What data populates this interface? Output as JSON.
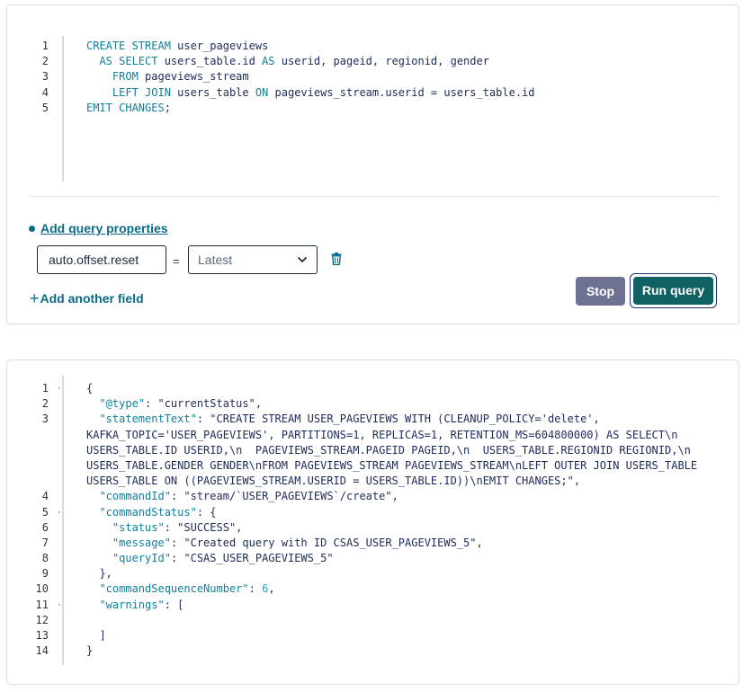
{
  "editor": {
    "line_numbers": [
      "1",
      "2",
      "3",
      "4",
      "5"
    ],
    "lines": [
      [
        {
          "t": "CREATE STREAM",
          "c": "kw"
        },
        {
          "t": " user_pageviews",
          "c": ""
        }
      ],
      [
        {
          "t": "  AS SELECT",
          "c": "kw"
        },
        {
          "t": " users_table.id ",
          "c": ""
        },
        {
          "t": "AS",
          "c": "kw"
        },
        {
          "t": " userid, pageid, regionid, gender",
          "c": ""
        }
      ],
      [
        {
          "t": "    FROM",
          "c": "kw"
        },
        {
          "t": " pageviews_stream",
          "c": ""
        }
      ],
      [
        {
          "t": "    LEFT JOIN",
          "c": "kw"
        },
        {
          "t": " users_table ",
          "c": ""
        },
        {
          "t": "ON",
          "c": "kw"
        },
        {
          "t": " pageviews_stream.userid = users_table.id",
          "c": ""
        }
      ],
      [
        {
          "t": "EMIT CHANGES",
          "c": "kw"
        },
        {
          "t": ";",
          "c": ""
        }
      ]
    ]
  },
  "properties": {
    "add_label": "Add query properties",
    "property_name": "auto.offset.reset",
    "equals": "=",
    "selected_value": "Latest",
    "add_field_label": "Add another field"
  },
  "buttons": {
    "stop_label": "Stop",
    "run_label": "Run query"
  },
  "result": {
    "line_numbers": [
      "1",
      "2",
      "3",
      "",
      "",
      "",
      "",
      "4",
      "5",
      "6",
      "7",
      "8",
      "9",
      "10",
      "11",
      "12",
      "13",
      "14"
    ],
    "fold_marks": [
      true,
      false,
      false,
      false,
      false,
      false,
      false,
      false,
      true,
      false,
      false,
      false,
      false,
      false,
      true,
      false,
      false,
      false
    ],
    "lines": [
      [
        {
          "t": "{",
          "c": ""
        }
      ],
      [
        {
          "t": "  ",
          "c": ""
        },
        {
          "t": "\"@type\"",
          "c": "key"
        },
        {
          "t": ": \"currentStatus\",",
          "c": ""
        }
      ],
      [
        {
          "t": "  ",
          "c": ""
        },
        {
          "t": "\"statementText\"",
          "c": "key"
        },
        {
          "t": ": \"CREATE STREAM USER_PAGEVIEWS WITH (CLEANUP_POLICY='delete',",
          "c": ""
        }
      ],
      [
        {
          "t": "KAFKA_TOPIC='USER_PAGEVIEWS', PARTITIONS=1, REPLICAS=1, RETENTION_MS=604800000) AS SELECT\\n",
          "c": ""
        }
      ],
      [
        {
          "t": "USERS_TABLE.ID USERID,\\n  PAGEVIEWS_STREAM.PAGEID PAGEID,\\n  USERS_TABLE.REGIONID REGIONID,\\n",
          "c": ""
        }
      ],
      [
        {
          "t": "USERS_TABLE.GENDER GENDER\\nFROM PAGEVIEWS_STREAM PAGEVIEWS_STREAM\\nLEFT OUTER JOIN USERS_TABLE",
          "c": ""
        }
      ],
      [
        {
          "t": "USERS_TABLE ON ((PAGEVIEWS_STREAM.USERID = USERS_TABLE.ID))\\nEMIT CHANGES;\",",
          "c": ""
        }
      ],
      [
        {
          "t": "  ",
          "c": ""
        },
        {
          "t": "\"commandId\"",
          "c": "key"
        },
        {
          "t": ": \"stream/`USER_PAGEVIEWS`/create\",",
          "c": ""
        }
      ],
      [
        {
          "t": "  ",
          "c": ""
        },
        {
          "t": "\"commandStatus\"",
          "c": "key"
        },
        {
          "t": ": {",
          "c": ""
        }
      ],
      [
        {
          "t": "    ",
          "c": ""
        },
        {
          "t": "\"status\"",
          "c": "key"
        },
        {
          "t": ": \"SUCCESS\",",
          "c": ""
        }
      ],
      [
        {
          "t": "    ",
          "c": ""
        },
        {
          "t": "\"message\"",
          "c": "key"
        },
        {
          "t": ": \"Created query with ID CSAS_USER_PAGEVIEWS_5\",",
          "c": ""
        }
      ],
      [
        {
          "t": "    ",
          "c": ""
        },
        {
          "t": "\"queryId\"",
          "c": "key"
        },
        {
          "t": ": \"CSAS_USER_PAGEVIEWS_5\"",
          "c": ""
        }
      ],
      [
        {
          "t": "  },",
          "c": ""
        }
      ],
      [
        {
          "t": "  ",
          "c": ""
        },
        {
          "t": "\"commandSequenceNumber\"",
          "c": "key"
        },
        {
          "t": ": ",
          "c": ""
        },
        {
          "t": "6",
          "c": "num"
        },
        {
          "t": ",",
          "c": ""
        }
      ],
      [
        {
          "t": "  ",
          "c": ""
        },
        {
          "t": "\"warnings\"",
          "c": "key"
        },
        {
          "t": ": [",
          "c": ""
        }
      ],
      [
        {
          "t": "",
          "c": ""
        }
      ],
      [
        {
          "t": "  ]",
          "c": ""
        }
      ],
      [
        {
          "t": "}",
          "c": ""
        }
      ]
    ]
  },
  "colors": {
    "accent": "#0b6b87",
    "run_button": "#0f6164",
    "stop_button": "#6e7192",
    "keyword": "#0f7f9a"
  },
  "icons": [
    "chevron-down-icon",
    "trash-icon",
    "plus-icon",
    "fold-arrow-icon"
  ]
}
